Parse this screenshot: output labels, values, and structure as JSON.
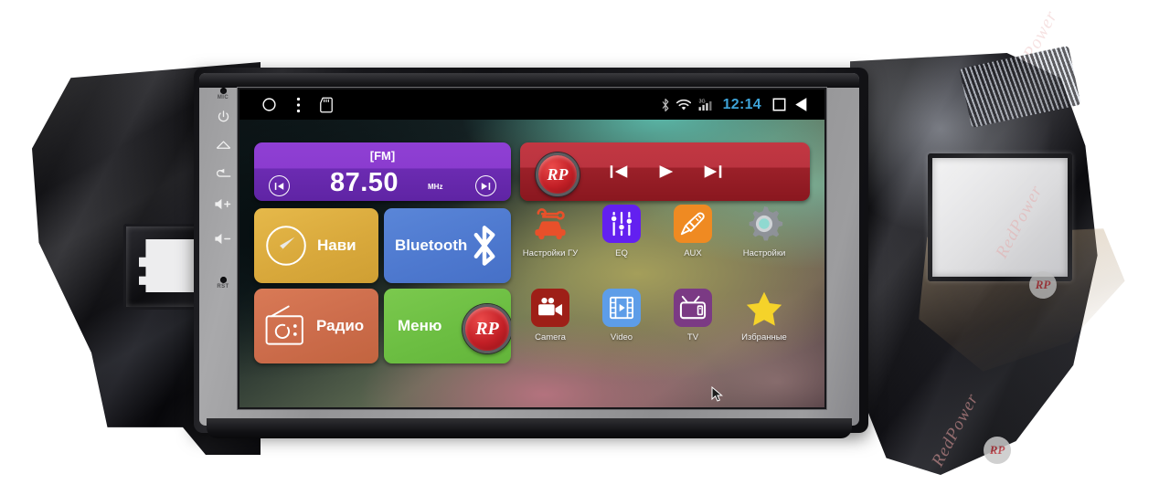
{
  "product": {
    "brand": "RedPower",
    "rp_mark": "RP"
  },
  "bezel": {
    "mic_label": "MIC",
    "reset_label": "RST",
    "buttons": [
      {
        "name": "power",
        "icon": "power-icon"
      },
      {
        "name": "home",
        "icon": "home-icon"
      },
      {
        "name": "back",
        "icon": "back-arrow-icon"
      },
      {
        "name": "volume-up",
        "icon": "volume-up-icon"
      },
      {
        "name": "volume-down",
        "icon": "volume-down-icon"
      }
    ]
  },
  "statusbar": {
    "clock": "12:14",
    "left_icons": [
      "home-circle-icon",
      "overflow-menu-icon",
      "sd-card-icon"
    ],
    "right_icons": [
      "bluetooth-icon",
      "wifi-icon",
      "3g-signal-icon"
    ],
    "nav_icons": [
      "recents-square-icon",
      "back-triangle-icon"
    ],
    "network_label": "3G",
    "clock_color": "#3ea3d8"
  },
  "widgets": {
    "fm": {
      "title": "[FM]",
      "frequency": "87.50",
      "unit": "MHz",
      "prev_label": "prev-station",
      "next_label": "next-station",
      "color": "#8b3ccf"
    },
    "media": {
      "logo": "RP",
      "prev_label": "previous-track",
      "play_label": "play",
      "next_label": "next-track",
      "color": "#bb3440"
    }
  },
  "tiles": [
    {
      "id": "navi",
      "label": "Нави",
      "icon": "compass-icon",
      "color": "#d9a93c"
    },
    {
      "id": "bluetooth",
      "label": "Bluetooth",
      "icon": "bluetooth-icon",
      "color": "#4e79cf"
    },
    {
      "id": "radio",
      "label": "Радио",
      "icon": "radio-icon",
      "color": "#cc6c4b"
    },
    {
      "id": "menu",
      "label": "Меню",
      "icon": "rp-logo-icon",
      "color": "#6cbe42"
    }
  ],
  "app_grid": {
    "row1": [
      {
        "id": "hu-settings",
        "label": "Настройки ГУ",
        "icon": "car-wrench-icon",
        "color": "#e8502a"
      },
      {
        "id": "eq",
        "label": "EQ",
        "icon": "equalizer-sliders-icon",
        "color": "#6320f0"
      },
      {
        "id": "aux",
        "label": "AUX",
        "icon": "audio-jack-icon",
        "color": "#ef8a22"
      },
      {
        "id": "settings",
        "label": "Настройки",
        "icon": "gear-icon",
        "color": "#8e9298"
      }
    ],
    "row2": [
      {
        "id": "camera",
        "label": "Camera",
        "icon": "camcorder-icon",
        "color": "#9e1f17"
      },
      {
        "id": "video",
        "label": "Video",
        "icon": "film-play-icon",
        "color": "#5d9de8"
      },
      {
        "id": "tv",
        "label": "TV",
        "icon": "television-icon",
        "color": "#7b3a84"
      },
      {
        "id": "favorites",
        "label": "Избранные",
        "icon": "star-icon",
        "color": "#f5d32a"
      }
    ]
  },
  "watermark": {
    "text": "RedPower",
    "mark": "RP"
  }
}
